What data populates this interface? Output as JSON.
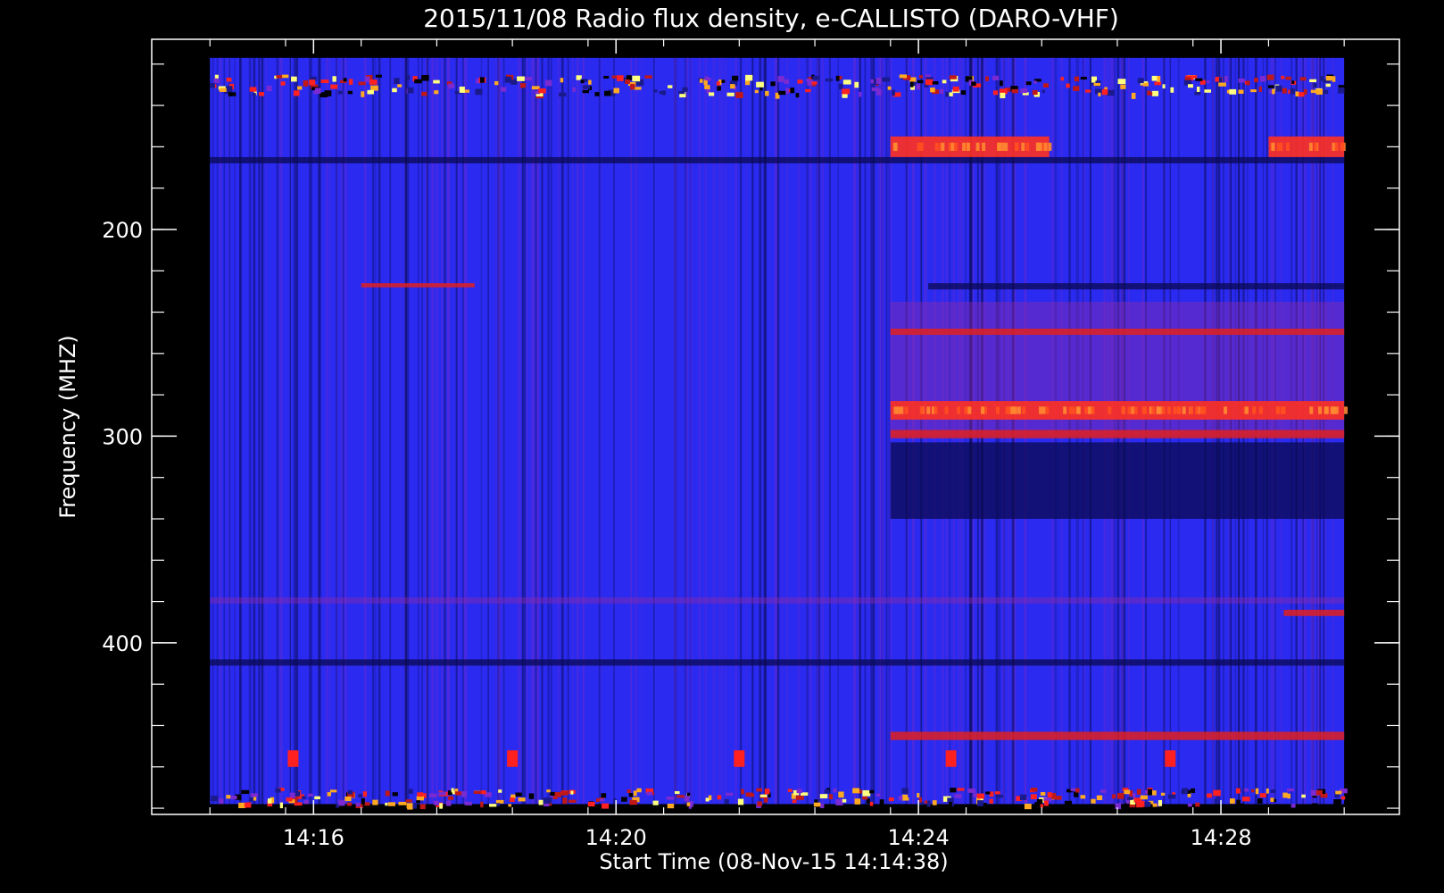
{
  "chart_data": {
    "type": "heatmap",
    "title": "2015/11/08  Radio flux density, e-CALLISTO (DARO-VHF)",
    "xlabel": "Start Time (08-Nov-15 14:14:38)",
    "ylabel": "Frequency (MHZ)",
    "x_ticks": [
      {
        "label": "14:16",
        "t": 1.37
      },
      {
        "label": "14:20",
        "t": 5.37
      },
      {
        "label": "14:24",
        "t": 9.37
      },
      {
        "label": "14:28",
        "t": 13.37
      }
    ],
    "y_ticks": [
      {
        "label": "200",
        "f": 200
      },
      {
        "label": "300",
        "f": 300
      },
      {
        "label": "400",
        "f": 400
      }
    ],
    "xlim_minutes_from_start": [
      -0.77,
      15.73
    ],
    "ylim_mhz": [
      108,
      483
    ],
    "data_extent_minutes_from_start": [
      0,
      15
    ],
    "data_extent_mhz": [
      117,
      478
    ],
    "y_inverted": true,
    "colormap": [
      "#000000",
      "#1a1a8c",
      "#2828e6",
      "#3030ff",
      "#7a2ad0",
      "#c01818",
      "#ff2020",
      "#ffaa20",
      "#ffff80"
    ],
    "background_level": "#2a2af0",
    "bands": [
      {
        "f0": 125,
        "f1": 134,
        "t0": 0,
        "t1": 15,
        "level": "speckle"
      },
      {
        "f0": 155,
        "f1": 165,
        "t0": 9.0,
        "t1": 11.1,
        "level": "strong"
      },
      {
        "f0": 155,
        "f1": 165,
        "t0": 14.0,
        "t1": 15.0,
        "level": "strong"
      },
      {
        "f0": 165,
        "f1": 168,
        "t0": 0,
        "t1": 15,
        "level": "dark"
      },
      {
        "f0": 226,
        "f1": 228,
        "t0": 2.0,
        "t1": 3.5,
        "level": "medium"
      },
      {
        "f0": 226,
        "f1": 229,
        "t0": 9.5,
        "t1": 15.0,
        "level": "dark"
      },
      {
        "f0": 235,
        "f1": 300,
        "t0": 9.0,
        "t1": 15.0,
        "level": "weak"
      },
      {
        "f0": 248,
        "f1": 251,
        "t0": 9.0,
        "t1": 15.0,
        "level": "medium"
      },
      {
        "f0": 283,
        "f1": 292,
        "t0": 9.0,
        "t1": 15.0,
        "level": "strong"
      },
      {
        "f0": 297,
        "f1": 301,
        "t0": 9.0,
        "t1": 15.0,
        "level": "medium"
      },
      {
        "f0": 303,
        "f1": 340,
        "t0": 9.0,
        "t1": 15.0,
        "level": "dark"
      },
      {
        "f0": 378,
        "f1": 381,
        "t0": 0,
        "t1": 15.0,
        "level": "weak"
      },
      {
        "f0": 384,
        "f1": 387,
        "t0": 14.2,
        "t1": 15.0,
        "level": "medium"
      },
      {
        "f0": 408,
        "f1": 411,
        "t0": 0,
        "t1": 15.0,
        "level": "dark"
      },
      {
        "f0": 443,
        "f1": 447,
        "t0": 9.0,
        "t1": 15.0,
        "level": "medium"
      },
      {
        "f0": 470,
        "f1": 478,
        "t0": 0,
        "t1": 15.0,
        "level": "speckle"
      }
    ],
    "bursts": [
      {
        "t": 1.1,
        "f0": 452,
        "f1": 460
      },
      {
        "t": 4.0,
        "f0": 452,
        "f1": 460
      },
      {
        "t": 7.0,
        "f0": 452,
        "f1": 460
      },
      {
        "t": 9.8,
        "f0": 452,
        "f1": 460
      },
      {
        "t": 12.7,
        "f0": 452,
        "f1": 460
      }
    ],
    "grid": false,
    "legend": "none"
  }
}
